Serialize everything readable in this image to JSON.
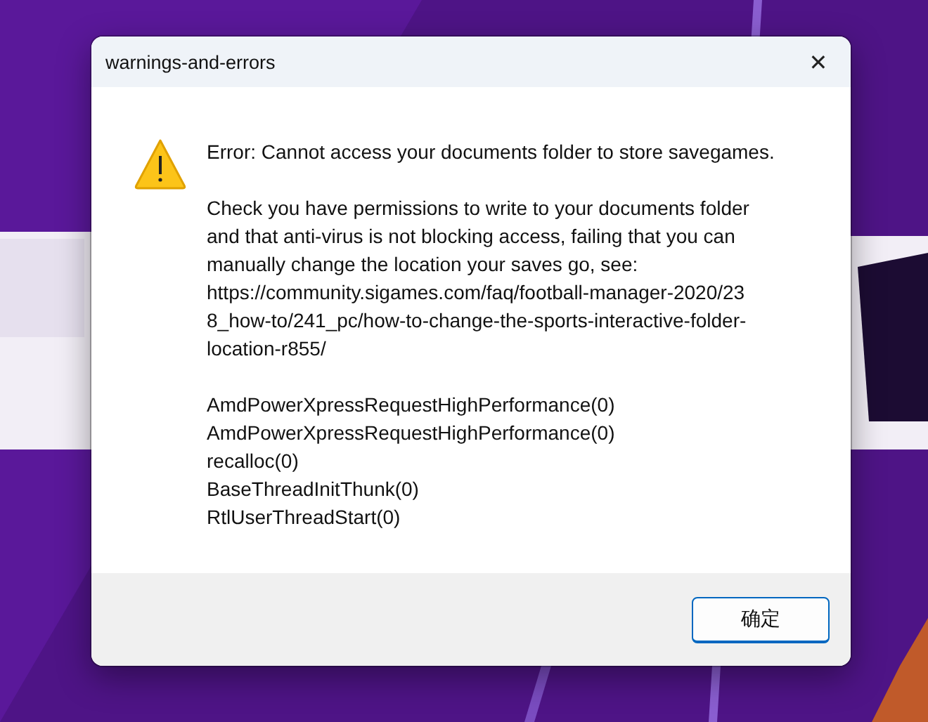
{
  "window": {
    "title": "warnings-and-errors",
    "close": "✕"
  },
  "message": {
    "paragraphs": [
      [
        "Error: Cannot access your documents folder to store savegames."
      ],
      [
        "Check you have permissions to write to your documents folder",
        "and that anti-virus is not blocking access, failing that you can",
        "manually change the location your saves go, see:",
        "https://community.sigames.com/faq/football-manager-2020/23",
        "8_how-to/241_pc/how-to-change-the-sports-interactive-folder-",
        "location-r855/"
      ],
      [
        "AmdPowerXpressRequestHighPerformance(0)",
        "AmdPowerXpressRequestHighPerformance(0)",
        "recalloc(0)",
        "BaseThreadInitThunk(0)",
        "RtlUserThreadStart(0)"
      ]
    ]
  },
  "buttons": [
    "确定"
  ]
}
